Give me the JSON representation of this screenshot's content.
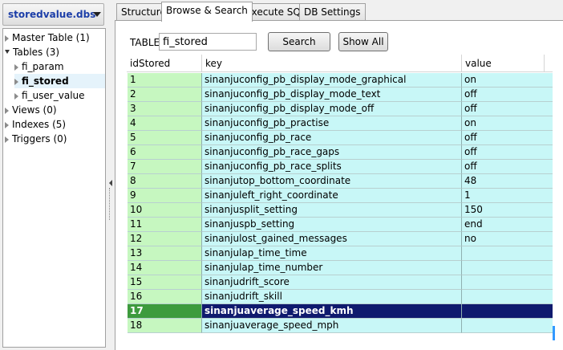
{
  "db_selector": {
    "label": "storedvalue.dbs"
  },
  "tree": {
    "nodes": [
      {
        "label": "Master Table (1)",
        "expanded": false,
        "level": 0
      },
      {
        "label": "Tables (3)",
        "expanded": true,
        "level": 0
      },
      {
        "label": "fi_param",
        "expanded": false,
        "level": 1
      },
      {
        "label": "fi_stored",
        "expanded": false,
        "level": 1,
        "selected": true
      },
      {
        "label": "fi_user_value",
        "expanded": false,
        "level": 1
      },
      {
        "label": "Views (0)",
        "expanded": false,
        "level": 0
      },
      {
        "label": "Indexes (5)",
        "expanded": false,
        "level": 0
      },
      {
        "label": "Triggers (0)",
        "expanded": false,
        "level": 0
      }
    ]
  },
  "tabs": [
    {
      "label": "Structure",
      "active": false
    },
    {
      "label": "Browse & Search",
      "active": true
    },
    {
      "label": "Execute SQL",
      "active": false
    },
    {
      "label": "DB Settings",
      "active": false
    }
  ],
  "search": {
    "table_label": "TABLE",
    "table_value": "fi_stored",
    "search_button": "Search",
    "show_all_button": "Show All"
  },
  "grid": {
    "columns": [
      "idStored",
      "key",
      "value"
    ],
    "selected_id": "17",
    "rows": [
      [
        "1",
        "sinanjuconfig_pb_display_mode_graphical",
        "on"
      ],
      [
        "2",
        "sinanjuconfig_pb_display_mode_text",
        "off"
      ],
      [
        "3",
        "sinanjuconfig_pb_display_mode_off",
        "off"
      ],
      [
        "4",
        "sinanjuconfig_pb_practise",
        "on"
      ],
      [
        "5",
        "sinanjuconfig_pb_race",
        "off"
      ],
      [
        "6",
        "sinanjuconfig_pb_race_gaps",
        "off"
      ],
      [
        "7",
        "sinanjuconfig_pb_race_splits",
        "off"
      ],
      [
        "8",
        "sinanjutop_bottom_coordinate",
        "48"
      ],
      [
        "9",
        "sinanjuleft_right_coordinate",
        "1"
      ],
      [
        "10",
        "sinanjusplit_setting",
        "150"
      ],
      [
        "11",
        "sinanjuspb_setting",
        "end"
      ],
      [
        "12",
        "sinanjulost_gained_messages",
        "no"
      ],
      [
        "13",
        "sinanjulap_time_time",
        ""
      ],
      [
        "14",
        "sinanjulap_time_number",
        ""
      ],
      [
        "15",
        "sinanjudrift_score",
        ""
      ],
      [
        "16",
        "sinanjudrift_skill",
        ""
      ],
      [
        "17",
        "sinanjuaverage_speed_kmh",
        ""
      ],
      [
        "18",
        "sinanjuaverage_speed_mph",
        ""
      ]
    ]
  }
}
